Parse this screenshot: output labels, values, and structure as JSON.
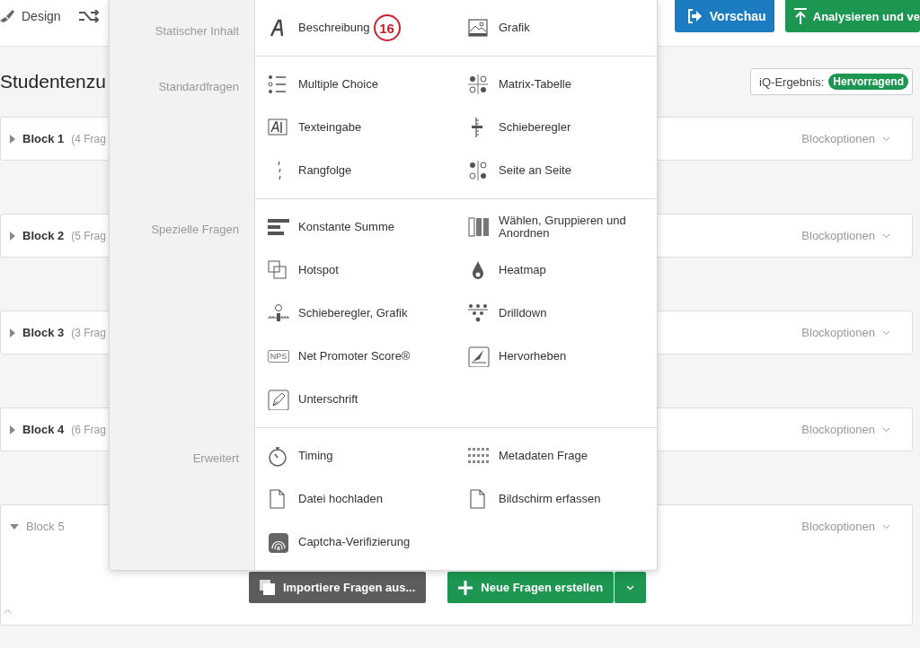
{
  "toolbar": {
    "design_label": "Design",
    "preview": "Vorschau",
    "publish": "Analysieren und ve"
  },
  "survey_title": "Studentenzu",
  "iq_score": {
    "label": "iQ-Ergebnis:",
    "value": "Hervorragend"
  },
  "blocks": [
    {
      "name": "Block 1",
      "count": "(4 Frag",
      "options": "Blockoptionen",
      "expanded": false
    },
    {
      "name": "Block 2",
      "count": "(5 Frag",
      "options": "Blockoptionen",
      "expanded": false
    },
    {
      "name": "Block 3",
      "count": "(3 Frag",
      "options": "Blockoptionen",
      "expanded": false
    },
    {
      "name": "Block 4",
      "count": "(6 Frag",
      "options": "Blockoptionen",
      "expanded": false
    },
    {
      "name": "Block 5",
      "options": "Blockoptionen",
      "expanded": true
    }
  ],
  "block_actions": {
    "import": "Importiere Fragen aus...",
    "create": "Neue Fragen erstellen"
  },
  "insert_menu": {
    "sections": [
      {
        "label": "Statischer Inhalt",
        "items": [
          {
            "kind": "text",
            "label": "Beschreibung",
            "badge": "16"
          },
          {
            "kind": "image",
            "label": "Grafik"
          }
        ]
      },
      {
        "label": "Standardfragen",
        "items": [
          {
            "kind": "multiple-choice",
            "label": "Multiple Choice"
          },
          {
            "kind": "matrix",
            "label": "Matrix-Tabelle"
          },
          {
            "kind": "text-entry",
            "label": "Texteingabe"
          },
          {
            "kind": "slider",
            "label": "Schieberegler"
          },
          {
            "kind": "rank",
            "label": "Rangfolge"
          },
          {
            "kind": "side-by-side",
            "label": "Seite an Seite"
          }
        ]
      },
      {
        "label": "Spezielle Fragen",
        "items": [
          {
            "kind": "constant-sum",
            "label": "Konstante Summe"
          },
          {
            "kind": "pick-group",
            "label": "Wählen, Gruppieren und Anordnen"
          },
          {
            "kind": "hotspot",
            "label": "Hotspot"
          },
          {
            "kind": "heatmap",
            "label": "Heatmap"
          },
          {
            "kind": "graphic-slider",
            "label": "Schieberegler, Grafik"
          },
          {
            "kind": "drilldown",
            "label": "Drilldown"
          },
          {
            "kind": "nps",
            "label": "Net Promoter Score®",
            "icon_text": "NPS"
          },
          {
            "kind": "highlight",
            "label": "Hervorheben"
          },
          {
            "kind": "signature",
            "label": "Unterschrift"
          }
        ]
      },
      {
        "label": "Erweitert",
        "items": [
          {
            "kind": "timing",
            "label": "Timing"
          },
          {
            "kind": "meta",
            "label": "Metadaten Frage"
          },
          {
            "kind": "file",
            "label": "Datei hochladen"
          },
          {
            "kind": "file",
            "label": "Bildschirm erfassen"
          },
          {
            "kind": "captcha",
            "label": "Captcha-Verifizierung"
          }
        ]
      }
    ]
  }
}
